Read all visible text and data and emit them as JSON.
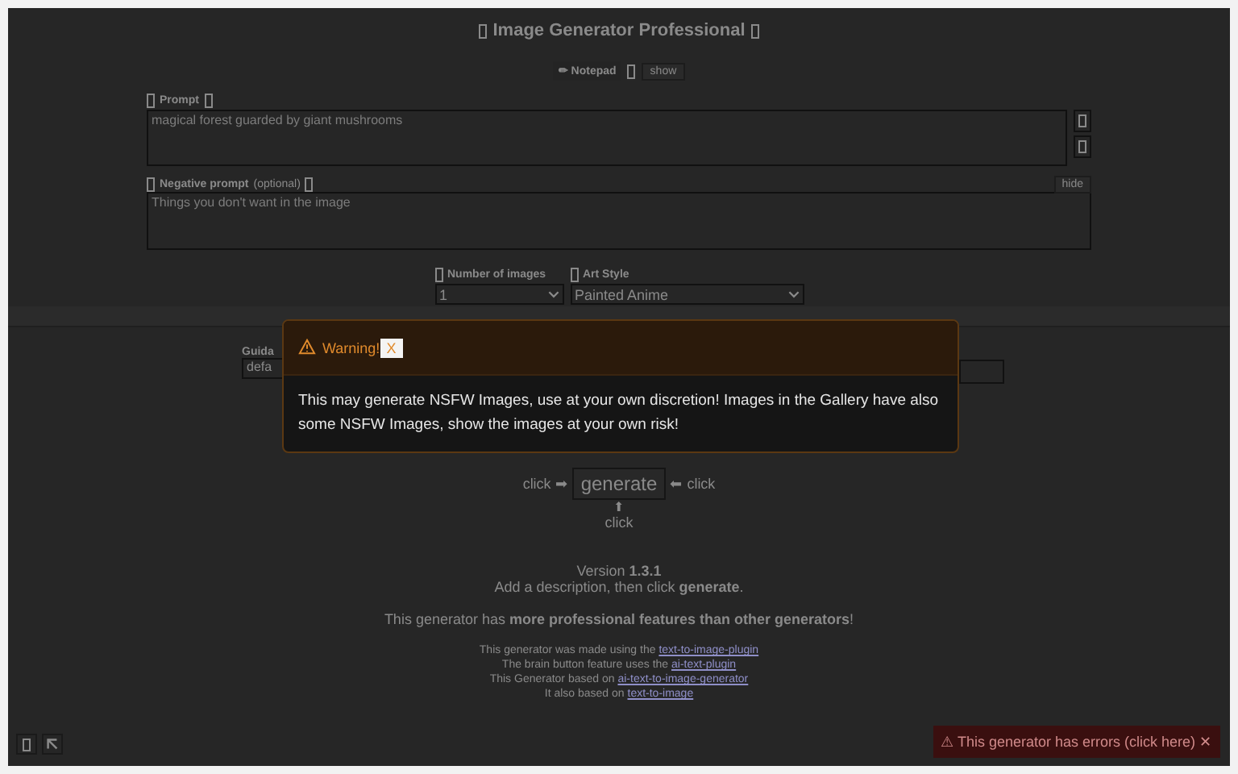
{
  "title": "Image Generator Professional",
  "notepad": {
    "label": "✏ Notepad",
    "button": "show"
  },
  "prompt": {
    "label": "Prompt",
    "placeholder": "magical forest guarded by giant mushrooms"
  },
  "negative_prompt": {
    "label": "Negative prompt",
    "note": "(optional)",
    "placeholder": "Things you don't want in the image",
    "button": "hide"
  },
  "selects": [
    {
      "label": "Number of images",
      "value": "1"
    },
    {
      "label": "Art Style",
      "value": "Painted Anime"
    }
  ],
  "guidance": {
    "label": "Guida",
    "value": "defa"
  },
  "modal": {
    "title": "Warning!",
    "close": "X",
    "message": "This may generate NSFW Images, use at your own discretion! Images in the Gallery have also some NSFW Images, show the images at your own risk!"
  },
  "generate": {
    "left": "click ➡",
    "button": "generate",
    "right": "⬅ click",
    "below_arrow": "⬆",
    "below": "click"
  },
  "version": "Version **1.3.1**",
  "hint": "Add a description, then click **generate**.",
  "tagline": "This generator has **more professional features than other generators**!",
  "credits": [
    {
      "text": "This generator was made using the",
      "link": "text-to-image-plugin"
    },
    {
      "text": "The brain button feature uses the",
      "link": "ai-text-plugin"
    },
    {
      "text": "This Generator based on",
      "link": "ai-text-to-image-generator"
    },
    {
      "text": "It also based on",
      "link": "text-to-image"
    }
  ],
  "error_bar": "⚠ This generator has errors (click here) ✕"
}
